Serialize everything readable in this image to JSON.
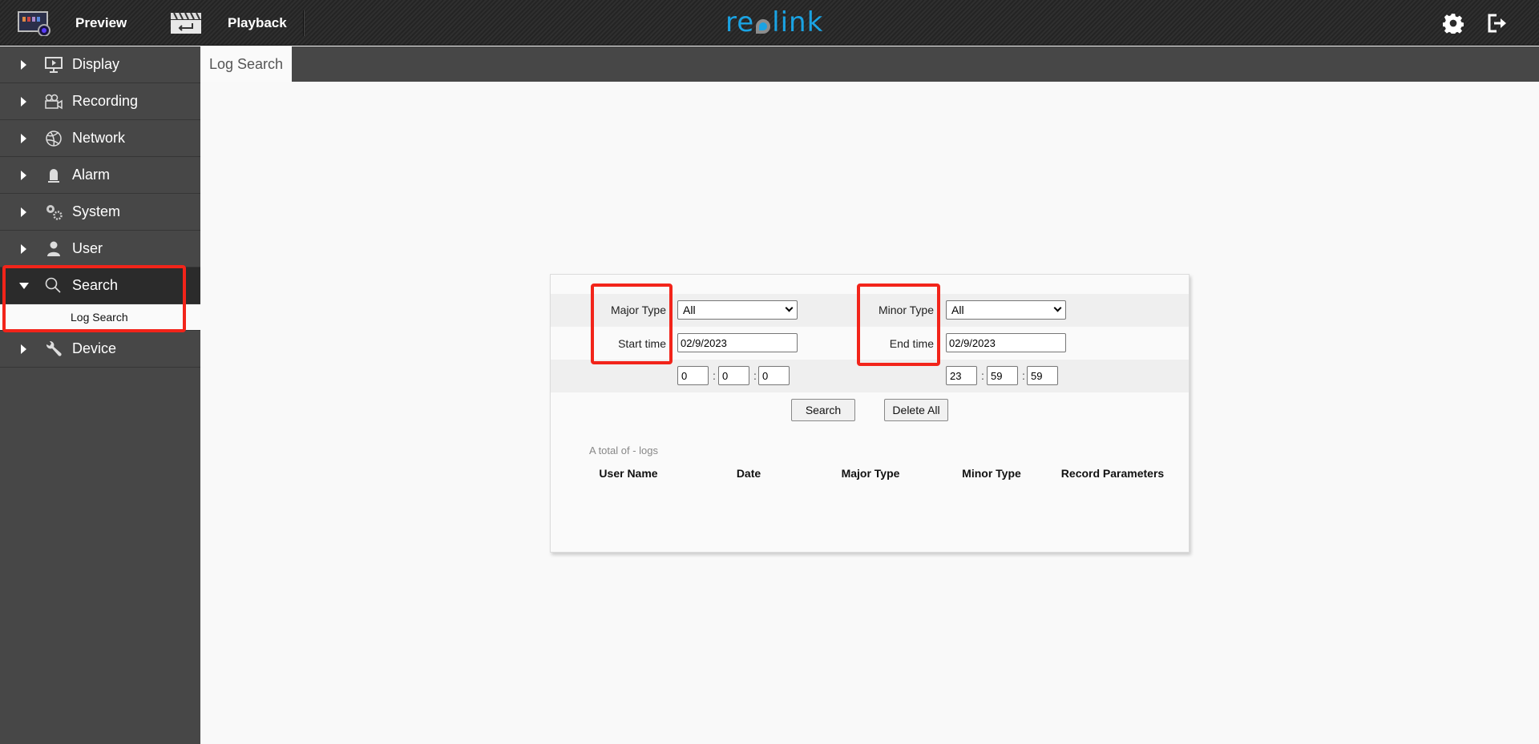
{
  "topbar": {
    "nav": [
      {
        "label": "Preview",
        "icon": "preview-monitor-icon"
      },
      {
        "label": "Playback",
        "icon": "clapperboard-icon"
      }
    ],
    "logo_text_left": "re",
    "logo_text_right": "link",
    "brand_color": "#1aa3e3",
    "icons": [
      "gear-icon",
      "logout-icon"
    ]
  },
  "sidebar": {
    "items": [
      {
        "label": "Display",
        "icon": "monitor-icon",
        "expanded": false
      },
      {
        "label": "Recording",
        "icon": "video-camera-icon",
        "expanded": false
      },
      {
        "label": "Network",
        "icon": "network-globe-icon",
        "expanded": false
      },
      {
        "label": "Alarm",
        "icon": "alarm-siren-icon",
        "expanded": false
      },
      {
        "label": "System",
        "icon": "gears-icon",
        "expanded": false
      },
      {
        "label": "User",
        "icon": "user-icon",
        "expanded": false
      },
      {
        "label": "Search",
        "icon": "search-icon",
        "expanded": true,
        "children": [
          {
            "label": "Log Search"
          }
        ]
      },
      {
        "label": "Device",
        "icon": "wrench-icon",
        "expanded": false
      }
    ]
  },
  "tabs": [
    {
      "label": "Log Search",
      "active": true
    }
  ],
  "form": {
    "major_type_label": "Major Type",
    "major_type_value": "All",
    "minor_type_label": "Minor Type",
    "minor_type_value": "All",
    "start_time_label": "Start time",
    "start_date": "02/9/2023",
    "end_time_label": "End time",
    "end_date": "02/9/2023",
    "start_hour": "0",
    "start_minute": "0",
    "start_second": "0",
    "end_hour": "23",
    "end_minute": "59",
    "end_second": "59",
    "time_separator": ":",
    "search_button": "Search",
    "delete_all_button": "Delete All"
  },
  "results": {
    "total_text": "A total of - logs",
    "columns": [
      "User Name",
      "Date",
      "Major Type",
      "Minor Type",
      "Record Parameters"
    ],
    "rows": []
  },
  "annotation_color": "#f2241a"
}
